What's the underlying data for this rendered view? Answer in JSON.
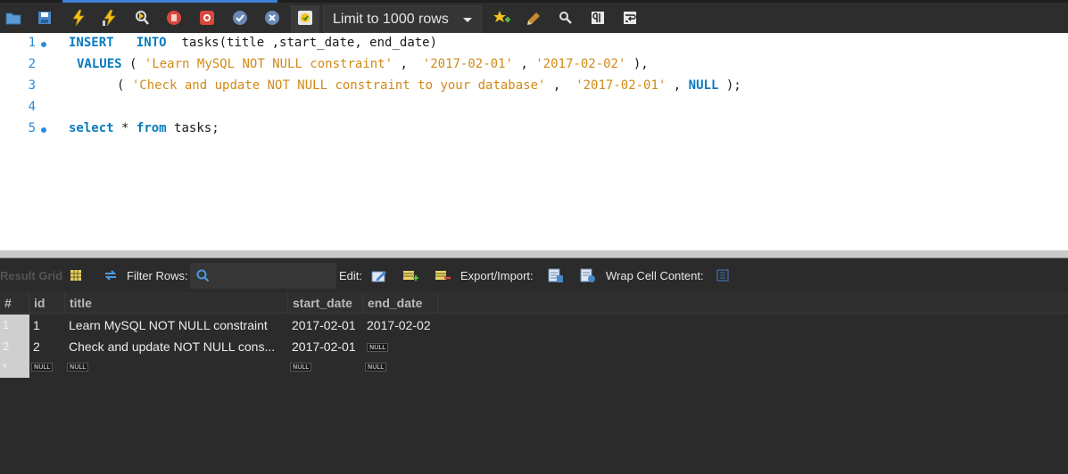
{
  "toolbar": {
    "icons": [
      "open-folder-icon",
      "save-icon",
      "execute-icon",
      "execute-line-icon",
      "explain-icon",
      "stop-icon",
      "toggle-error-icon",
      "commit-icon",
      "rollback-icon",
      "autocommit-icon",
      "beautify-icon",
      "find-icon",
      "invisible-chars-icon",
      "wrap-icon"
    ],
    "limit_label": "Limit to 1000 rows"
  },
  "editor": {
    "lines": [
      {
        "num": "1",
        "has_dot": true
      },
      {
        "num": "2",
        "has_dot": false
      },
      {
        "num": "3",
        "has_dot": false
      },
      {
        "num": "4",
        "has_dot": false
      },
      {
        "num": "5",
        "has_dot": true
      }
    ],
    "tokens": {
      "l1_insert": "INSERT",
      "l1_into": "INTO",
      "l1_rest": "tasks(title ,start_date, end_date)",
      "l2_values": "VALUES",
      "l2_open": "(",
      "l2_s1": "'Learn MySQL NOT NULL constraint'",
      "l2_c1": ",",
      "l2_s2": "'2017-02-01'",
      "l2_c2": ",",
      "l2_s3": "'2017-02-02'",
      "l2_close": "),",
      "l3_open": "(",
      "l3_s1": "'Check and update NOT NULL constraint to your database'",
      "l3_c1": ",",
      "l3_s2": "'2017-02-01'",
      "l3_c2": ",",
      "l3_null": "NULL",
      "l3_close": ");",
      "l5_select": "select",
      "l5_star": "*",
      "l5_from": "from",
      "l5_rest": "tasks;"
    }
  },
  "result_toolbar": {
    "result_grid_label": "Result Grid",
    "filter_label": "Filter Rows:",
    "filter_value": "",
    "edit_label": "Edit:",
    "export_label": "Export/Import:",
    "wrap_label": "Wrap Cell Content:"
  },
  "grid": {
    "columns": [
      "#",
      "id",
      "title",
      "start_date",
      "end_date"
    ],
    "rows": [
      {
        "num": "1",
        "id": "1",
        "title": "Learn MySQL NOT NULL constraint",
        "start_date": "2017-02-01",
        "end_date": "2017-02-02"
      },
      {
        "num": "2",
        "id": "2",
        "title": "Check and update NOT NULL cons...",
        "start_date": "2017-02-01",
        "end_date": "NULL"
      }
    ],
    "new_row": {
      "num": "*",
      "id": "NULL",
      "title": "NULL",
      "start_date": "NULL",
      "end_date": "NULL"
    }
  }
}
